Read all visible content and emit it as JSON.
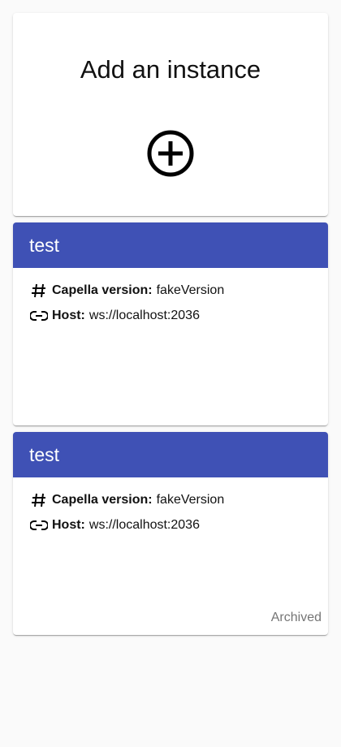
{
  "colors": {
    "header_bg": "#3f51b5",
    "page_bg": "#fafafa"
  },
  "add_card": {
    "title": "Add an instance",
    "icon": "add-circle-outline-icon"
  },
  "instances": [
    {
      "name": "test",
      "version_label": "Capella version:",
      "version": "fakeVersion",
      "host_label": "Host:",
      "host": "ws://localhost:2036",
      "status": ""
    },
    {
      "name": "test",
      "version_label": "Capella version:",
      "version": "fakeVersion",
      "host_label": "Host:",
      "host": "ws://localhost:2036",
      "status": "Archived"
    }
  ]
}
